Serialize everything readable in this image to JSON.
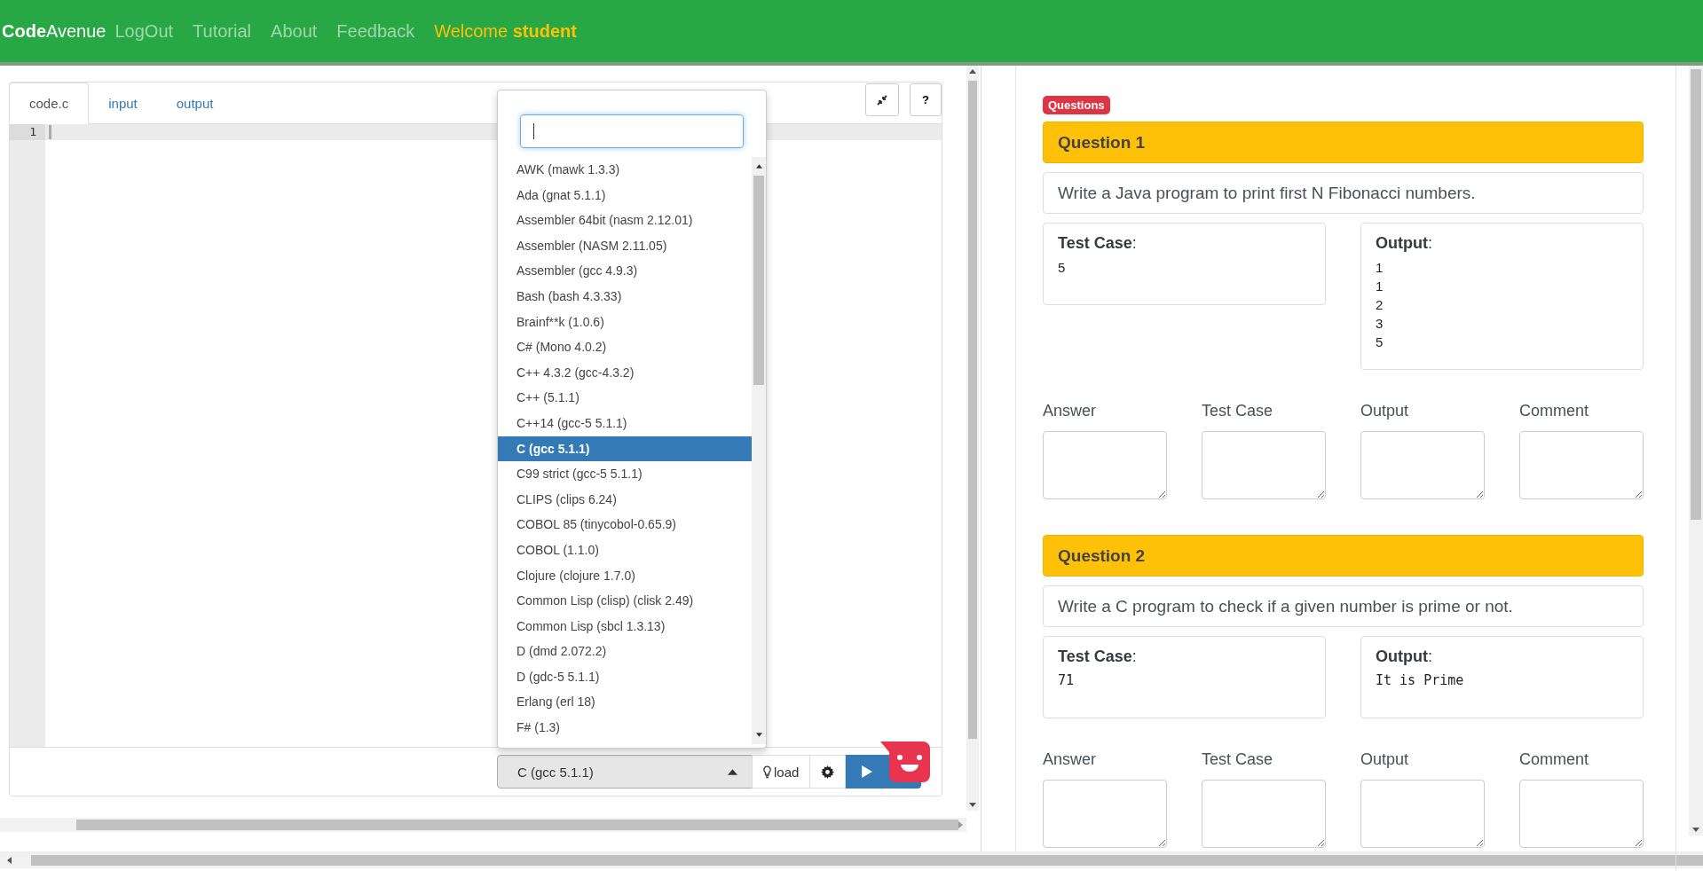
{
  "nav": {
    "brand": "**Code**Avenue",
    "links": [
      "LogOut",
      "Tutorial",
      "About",
      "Feedback"
    ],
    "welcome": "Welcome **student**"
  },
  "editor": {
    "tabs": [
      {
        "label": "code.c",
        "selected": true
      },
      {
        "label": "input",
        "selected": false
      },
      {
        "label": "output",
        "selected": false
      }
    ],
    "help_button": "?",
    "line_numbers": [
      "1"
    ],
    "language_select": {
      "value": "C (gcc 5.1.1)",
      "expanded": true
    },
    "load_button": "load",
    "language_menu": {
      "items": [
        {
          "label": "AWK (mawk 1.3.3)",
          "selected": false
        },
        {
          "label": "Ada (gnat 5.1.1)",
          "selected": false
        },
        {
          "label": "Assembler 64bit (nasm 2.12.01)",
          "selected": false
        },
        {
          "label": "Assembler (NASM 2.11.05)",
          "selected": false
        },
        {
          "label": "Assembler (gcc 4.9.3)",
          "selected": false
        },
        {
          "label": "Bash (bash 4.3.33)",
          "selected": false
        },
        {
          "label": "Brainf**k (1.0.6)",
          "selected": false
        },
        {
          "label": "C# (Mono 4.0.2)",
          "selected": false
        },
        {
          "label": "C++ 4.3.2 (gcc-4.3.2)",
          "selected": false
        },
        {
          "label": "C++ (5.1.1)",
          "selected": false
        },
        {
          "label": "C++14 (gcc-5 5.1.1)",
          "selected": false
        },
        {
          "label": "C (gcc 5.1.1)",
          "selected": true
        },
        {
          "label": "C99 strict (gcc-5 5.1.1)",
          "selected": false
        },
        {
          "label": "CLIPS (clips 6.24)",
          "selected": false
        },
        {
          "label": "COBOL 85 (tinycobol-0.65.9)",
          "selected": false
        },
        {
          "label": "COBOL (1.1.0)",
          "selected": false
        },
        {
          "label": "Clojure (clojure 1.7.0)",
          "selected": false
        },
        {
          "label": "Common Lisp (clisp) (clisk 2.49)",
          "selected": false
        },
        {
          "label": "Common Lisp (sbcl 1.3.13)",
          "selected": false
        },
        {
          "label": "D (dmd 2.072.2)",
          "selected": false
        },
        {
          "label": "D (gdc-5 5.1.1)",
          "selected": false
        },
        {
          "label": "Erlang (erl 18)",
          "selected": false
        },
        {
          "label": "F# (1.3)",
          "selected": false
        }
      ]
    }
  },
  "questions": {
    "badge": "Questions",
    "items": [
      {
        "title": "Question 1",
        "text": "Write a Java program to print first N Fibonacci numbers.",
        "test_case_label": "**Test Case**:",
        "test_case": [
          "5"
        ],
        "output_label": "**Output**:",
        "output": [
          "1",
          "1",
          "2",
          "3",
          "5"
        ],
        "kind": "plain",
        "fields": [
          "Answer",
          "Test Case",
          "Output",
          "Comment"
        ]
      },
      {
        "title": "Question 2",
        "text": "Write a C program to check if a given number is prime or not.",
        "test_case_label": "**Test Case**:",
        "test_case": [
          "71"
        ],
        "output_label": "**Output**:",
        "output": [
          "It is Prime"
        ],
        "kind": "code",
        "fields": [
          "Answer",
          "Test Case",
          "Output",
          "Comment"
        ]
      }
    ]
  }
}
